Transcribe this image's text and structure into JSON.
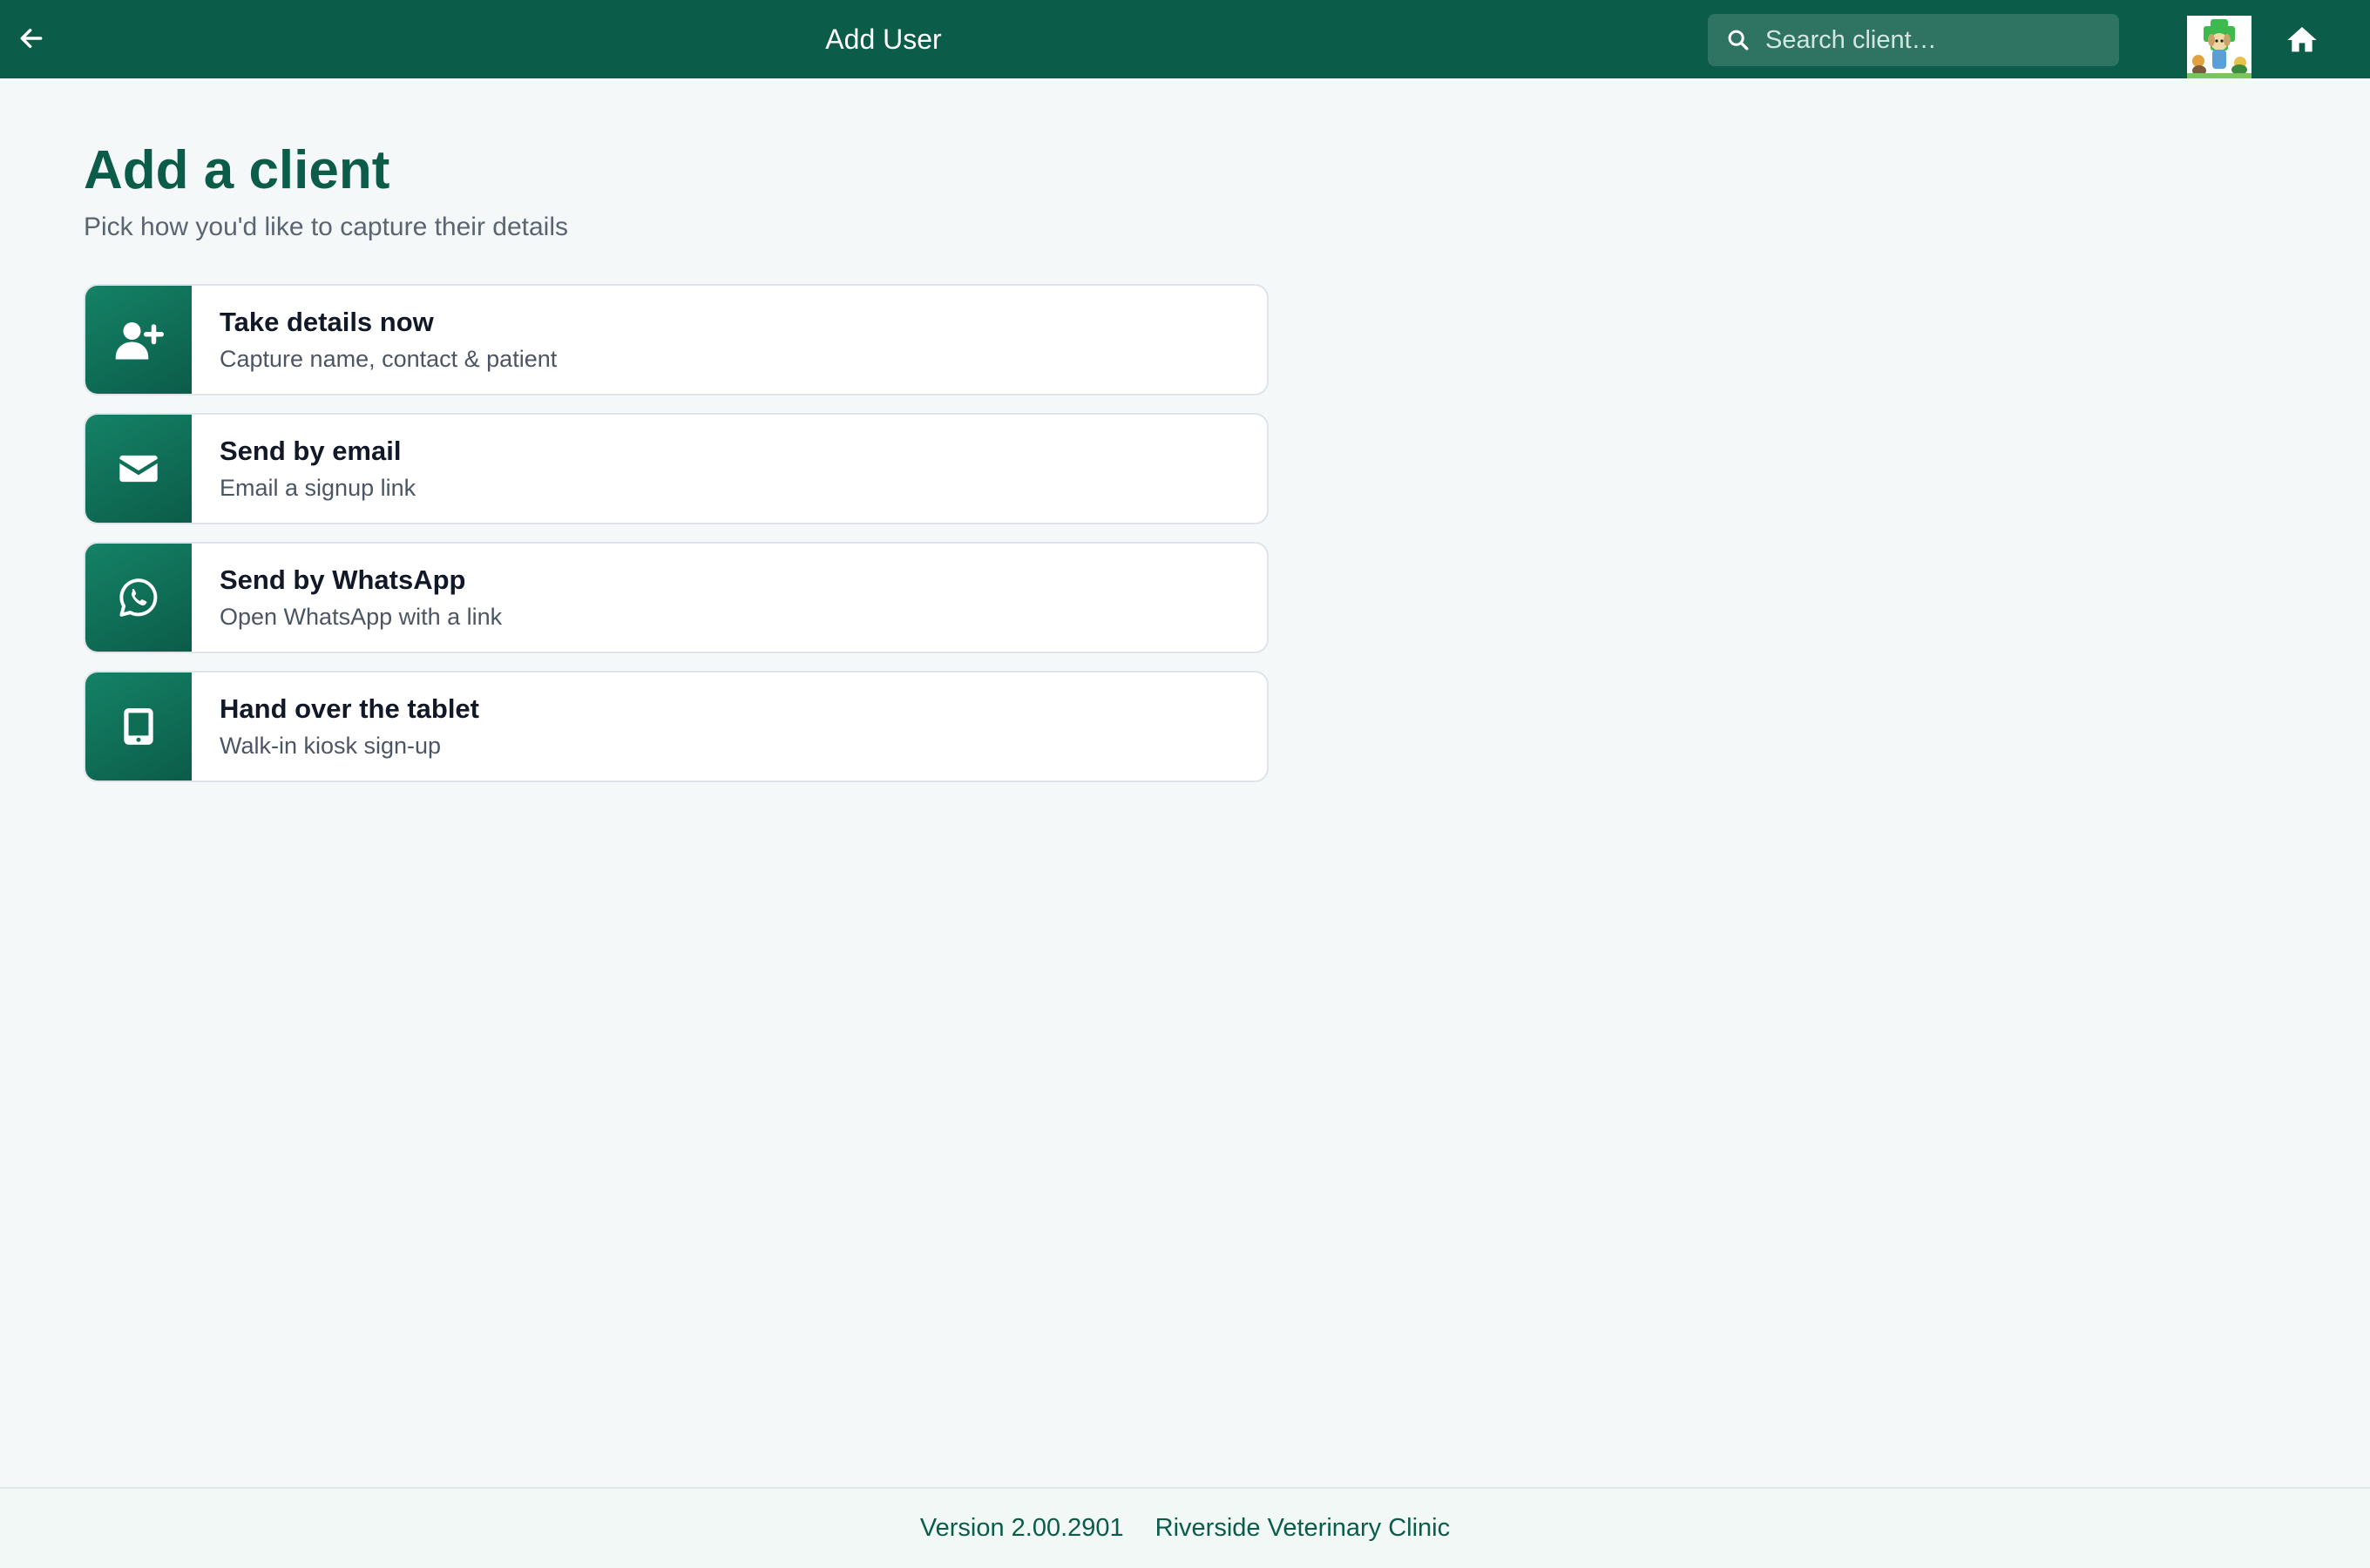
{
  "header": {
    "title": "Add User",
    "search_placeholder": "Search client…"
  },
  "main": {
    "title": "Add a client",
    "subtitle": "Pick how you'd like to capture their details",
    "options": [
      {
        "title": "Take details now",
        "description": "Capture name, contact & patient",
        "icon": "user-plus-icon"
      },
      {
        "title": "Send by email",
        "description": "Email a signup link",
        "icon": "envelope-icon"
      },
      {
        "title": "Send by WhatsApp",
        "description": "Open WhatsApp with a link",
        "icon": "whatsapp-icon"
      },
      {
        "title": "Hand over the tablet",
        "description": "Walk-in kiosk sign-up",
        "icon": "tablet-icon"
      }
    ]
  },
  "footer": {
    "version": "Version 2.00.2901",
    "clinic_name": "Riverside Veterinary Clinic"
  },
  "colors": {
    "brand": "#0b5c49",
    "search_bg": "#2f7462",
    "page_bg": "#f4f8f8"
  }
}
